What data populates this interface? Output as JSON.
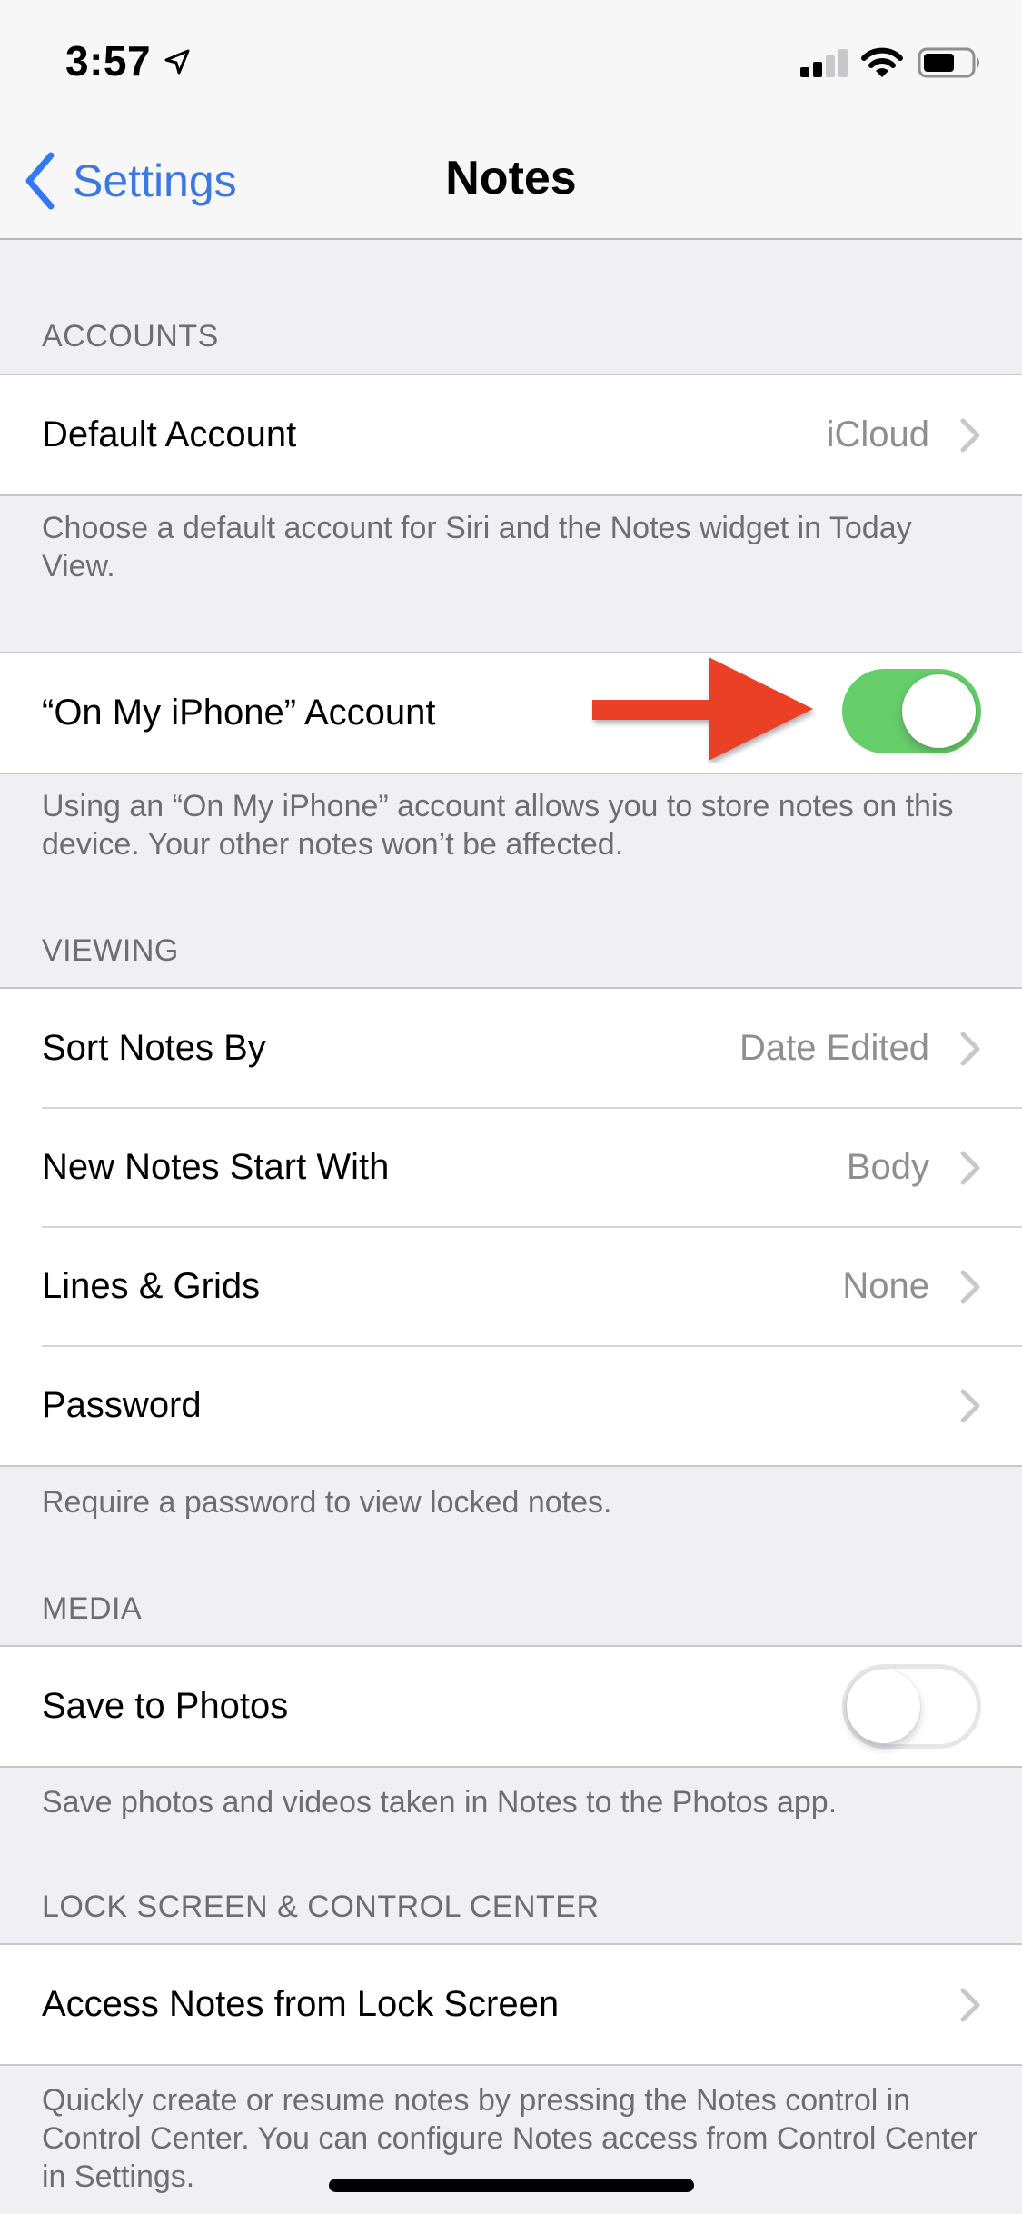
{
  "status_bar": {
    "time": "3:57",
    "location_icon": "location-arrow-icon",
    "signal_bars_filled": 2,
    "signal_bars_total": 4,
    "wifi_icon": "wifi-icon",
    "battery_level": 0.65
  },
  "nav": {
    "back_label": "Settings",
    "back_icon": "chevron-left-icon",
    "title": "Notes"
  },
  "accent_color": "#3478f6",
  "toggle_on_color": "#65cd6a",
  "annotation_arrow_color": "#e94027",
  "sections": {
    "accounts": {
      "header": "ACCOUNTS",
      "default_account": {
        "label": "Default Account",
        "value": "iCloud"
      },
      "default_footer": "Choose a default account for Siri and the Notes widget in Today View.",
      "on_my_iphone": {
        "label": "“On My iPhone” Account",
        "enabled": true
      },
      "on_my_iphone_footer": "Using an “On My iPhone” account allows you to store notes on this device. Your other notes won’t be affected."
    },
    "viewing": {
      "header": "VIEWING",
      "rows": [
        {
          "label": "Sort Notes By",
          "value": "Date Edited"
        },
        {
          "label": "New Notes Start With",
          "value": "Body"
        },
        {
          "label": "Lines & Grids",
          "value": "None"
        },
        {
          "label": "Password",
          "value": ""
        }
      ],
      "footer": "Require a password to view locked notes."
    },
    "media": {
      "header": "MEDIA",
      "save_to_photos": {
        "label": "Save to Photos",
        "enabled": false
      },
      "footer": "Save photos and videos taken in Notes to the Photos app."
    },
    "lock_screen": {
      "header": "LOCK SCREEN & CONTROL CENTER",
      "access_row": {
        "label": "Access Notes from Lock Screen"
      },
      "footer": "Quickly create or resume notes by pressing the Notes control in Control Center. You can configure Notes access from Control Center in Settings."
    }
  }
}
